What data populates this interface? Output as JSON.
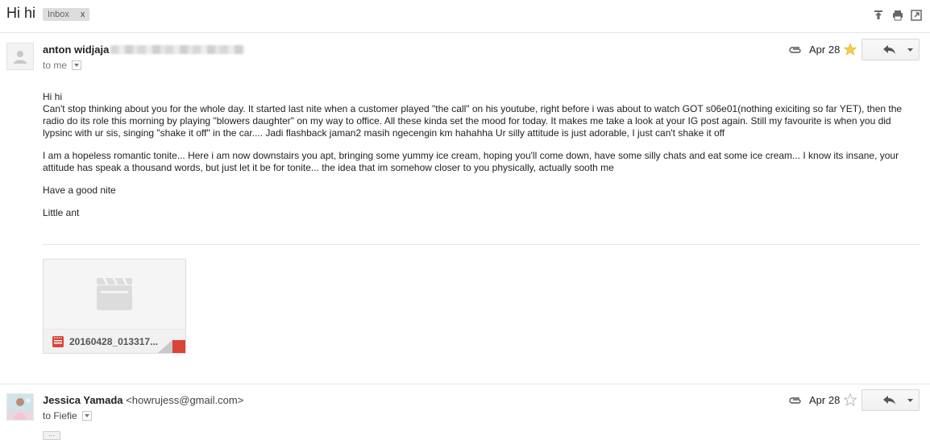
{
  "header": {
    "subject": "Hi hi",
    "label_chip": {
      "text": "Inbox",
      "remove": "x"
    },
    "icons": [
      "print-all-icon",
      "print-icon",
      "new-window-icon"
    ]
  },
  "message1": {
    "sender_name": "anton widjaja",
    "to_text": "to me",
    "date": "Apr 28",
    "starred": true,
    "paragraphs": [
      "Hi hi\nCan't stop thinking about you for the whole day. It started last nite when a customer played \"the call\" on his youtube, right before i was about to watch GOT s06e01(nothing exiciting so far YET), then the radio do its role this morning by playing \"blowers daughter\" on my way to office. All these kinda set the mood for today. It makes me take a look at your IG post again. Still my favourite is when you did lypsinc with ur sis, singing \"shake it off\" in the car.... Jadi flashback jaman2 masih ngecengin km hahahha Ur silly attitude is just adorable, I just can't shake it off",
      "I am a hopeless romantic tonite... Here i am now downstairs you apt, bringing some yummy ice cream, hoping you'll come down, have some silly chats and  eat some ice cream... I know its insane, your attitude has speak a thousand words, but just let it be for tonite... the idea that im somehow closer to you physically, actually sooth me",
      "Have a good nite",
      "Little ant"
    ],
    "attachment": {
      "filename": "20160428_013317...",
      "type_icon": "video-file-icon"
    }
  },
  "message2": {
    "sender_name": "Jessica Yamada",
    "sender_email": "<howrujess@gmail.com>",
    "to_text": "to Fiefie",
    "date": "Apr 28",
    "starred": false,
    "collapsed_marker": "···"
  },
  "colors": {
    "star_on": "#f7cb4d",
    "star_off": "#cccccc",
    "attachment_red": "#db4437"
  }
}
